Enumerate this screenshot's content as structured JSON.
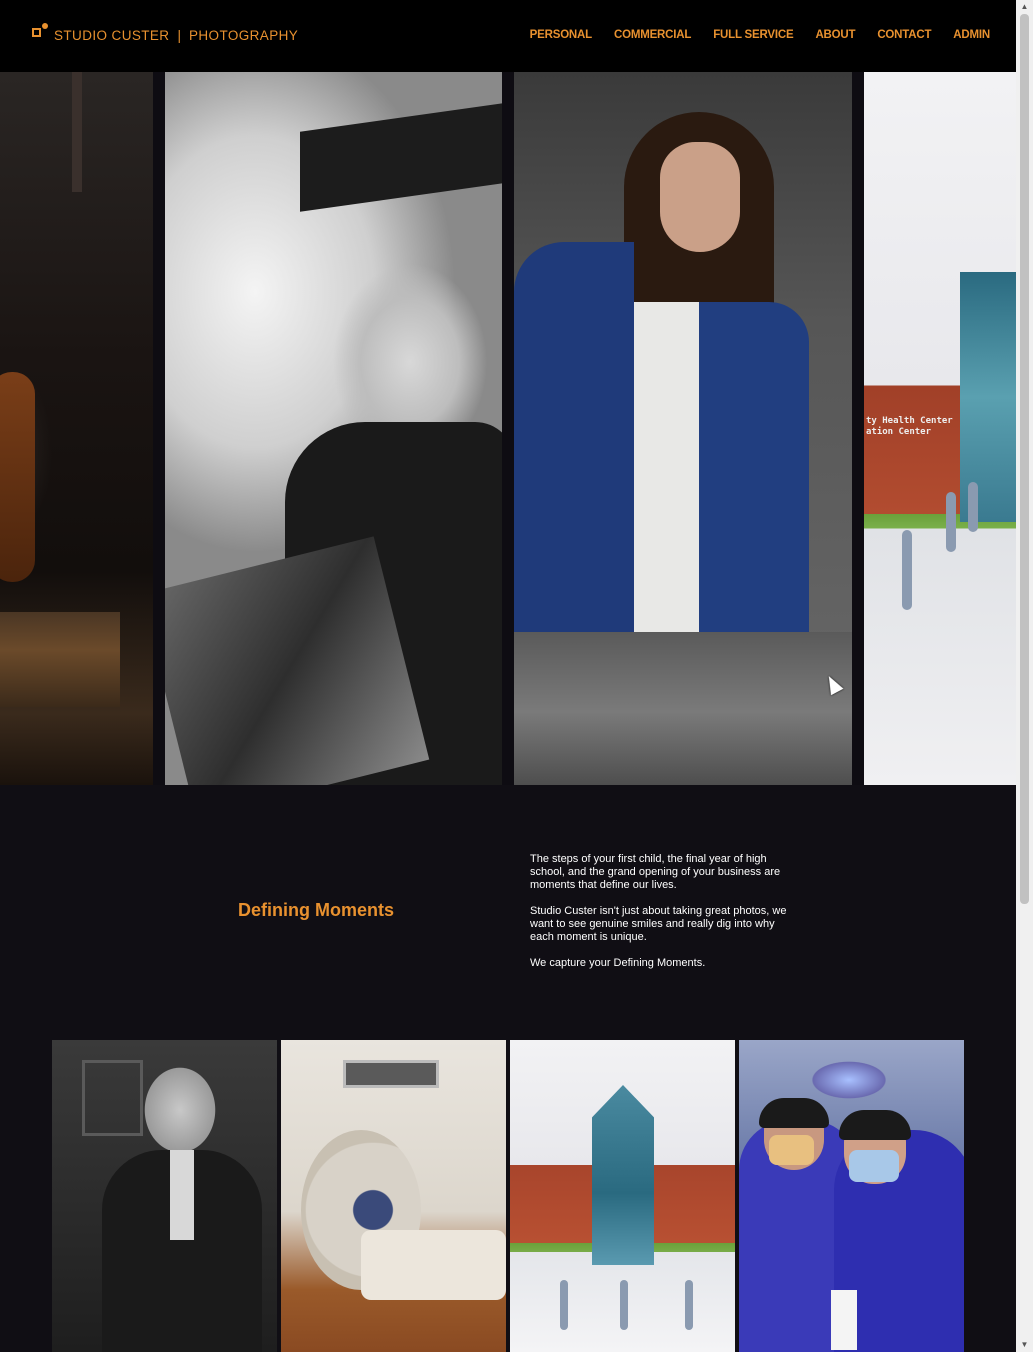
{
  "header": {
    "brand_name": "STUDIO CUSTER",
    "brand_separator": "|",
    "brand_tagline": "PHOTOGRAPHY",
    "nav": [
      {
        "label": "PERSONAL"
      },
      {
        "label": "COMMERCIAL"
      },
      {
        "label": "FULL SERVICE"
      },
      {
        "label": "ABOUT"
      },
      {
        "label": "CONTACT"
      },
      {
        "label": "ADMIN"
      }
    ]
  },
  "carousel": {
    "slide_4_sign": [
      "ty Health Center",
      "ation  Center"
    ]
  },
  "intro": {
    "title": "Defining Moments",
    "paragraphs": [
      "The steps of your first child, the final year of high school, and the grand opening of your business are moments that define our lives.",
      "Studio Custer isn't just about taking great photos, we want to see genuine smiles and really dig into why each moment is unique.",
      "We capture your Defining Moments."
    ]
  },
  "colors": {
    "accent": "#e8912f",
    "page_bg": "#100e14",
    "header_bg": "#000000",
    "body_text": "#ffffff"
  },
  "icons": {
    "logo": "studio-custer-logo-icon",
    "scroll_up": "scroll-up-arrow-icon",
    "scroll_down": "scroll-down-arrow-icon",
    "cursor": "mouse-pointer-icon"
  }
}
